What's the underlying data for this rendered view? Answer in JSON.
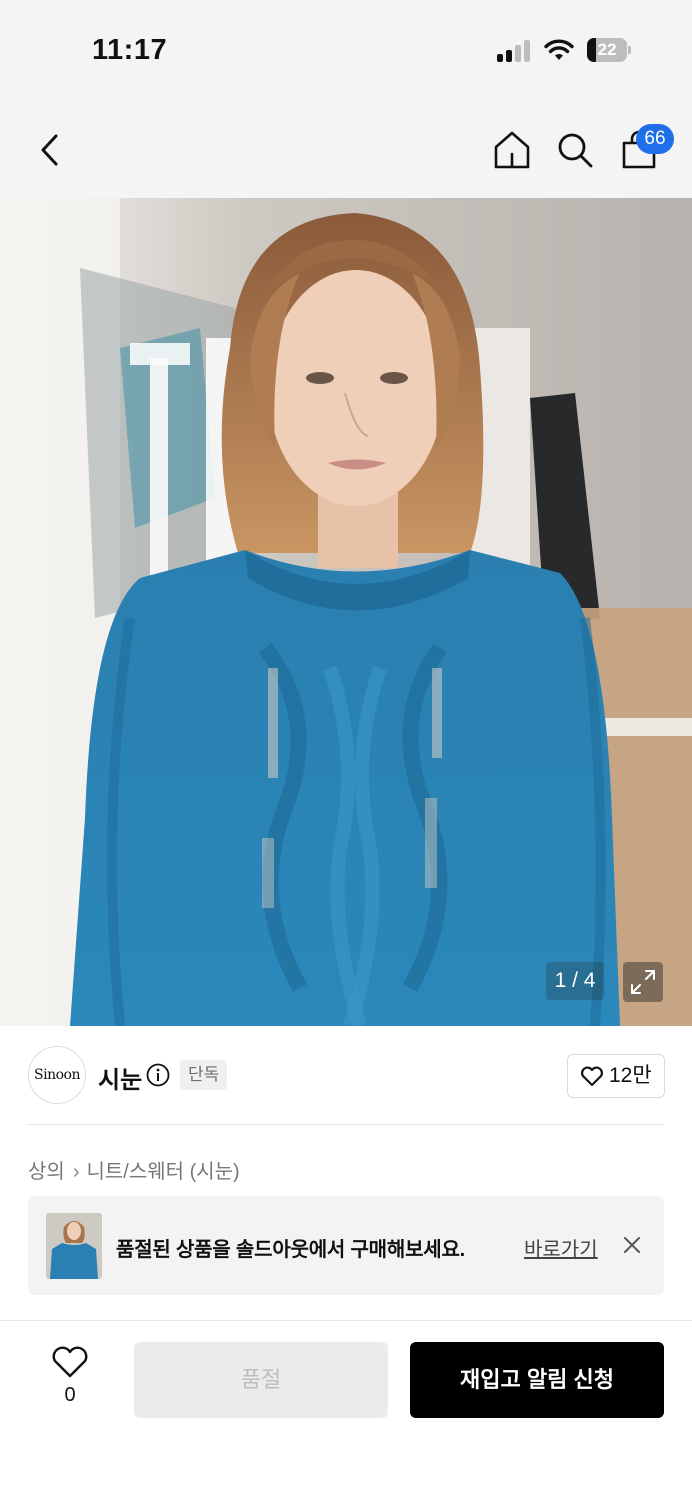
{
  "status_bar": {
    "time": "11:17",
    "battery": "22"
  },
  "nav": {
    "cart_count": "66"
  },
  "hero": {
    "counter": "1 / 4"
  },
  "brand": {
    "logo_text": "Sinoon",
    "name": "시눈",
    "tag": "단독",
    "likes": "12만"
  },
  "breadcrumb": {
    "level1": "상의",
    "level2": "니트/스웨터 (시눈)"
  },
  "banner": {
    "message": "품절된 상품을 솔드아웃에서 구매해보세요.",
    "link": "바로가기"
  },
  "bottom": {
    "wish_count": "0",
    "soldout_label": "품절",
    "restock_label": "재입고 알림 신청"
  },
  "colors": {
    "accent_blue": "#1f6fea",
    "sweater": "#2f86b6",
    "cta": "#000000"
  }
}
